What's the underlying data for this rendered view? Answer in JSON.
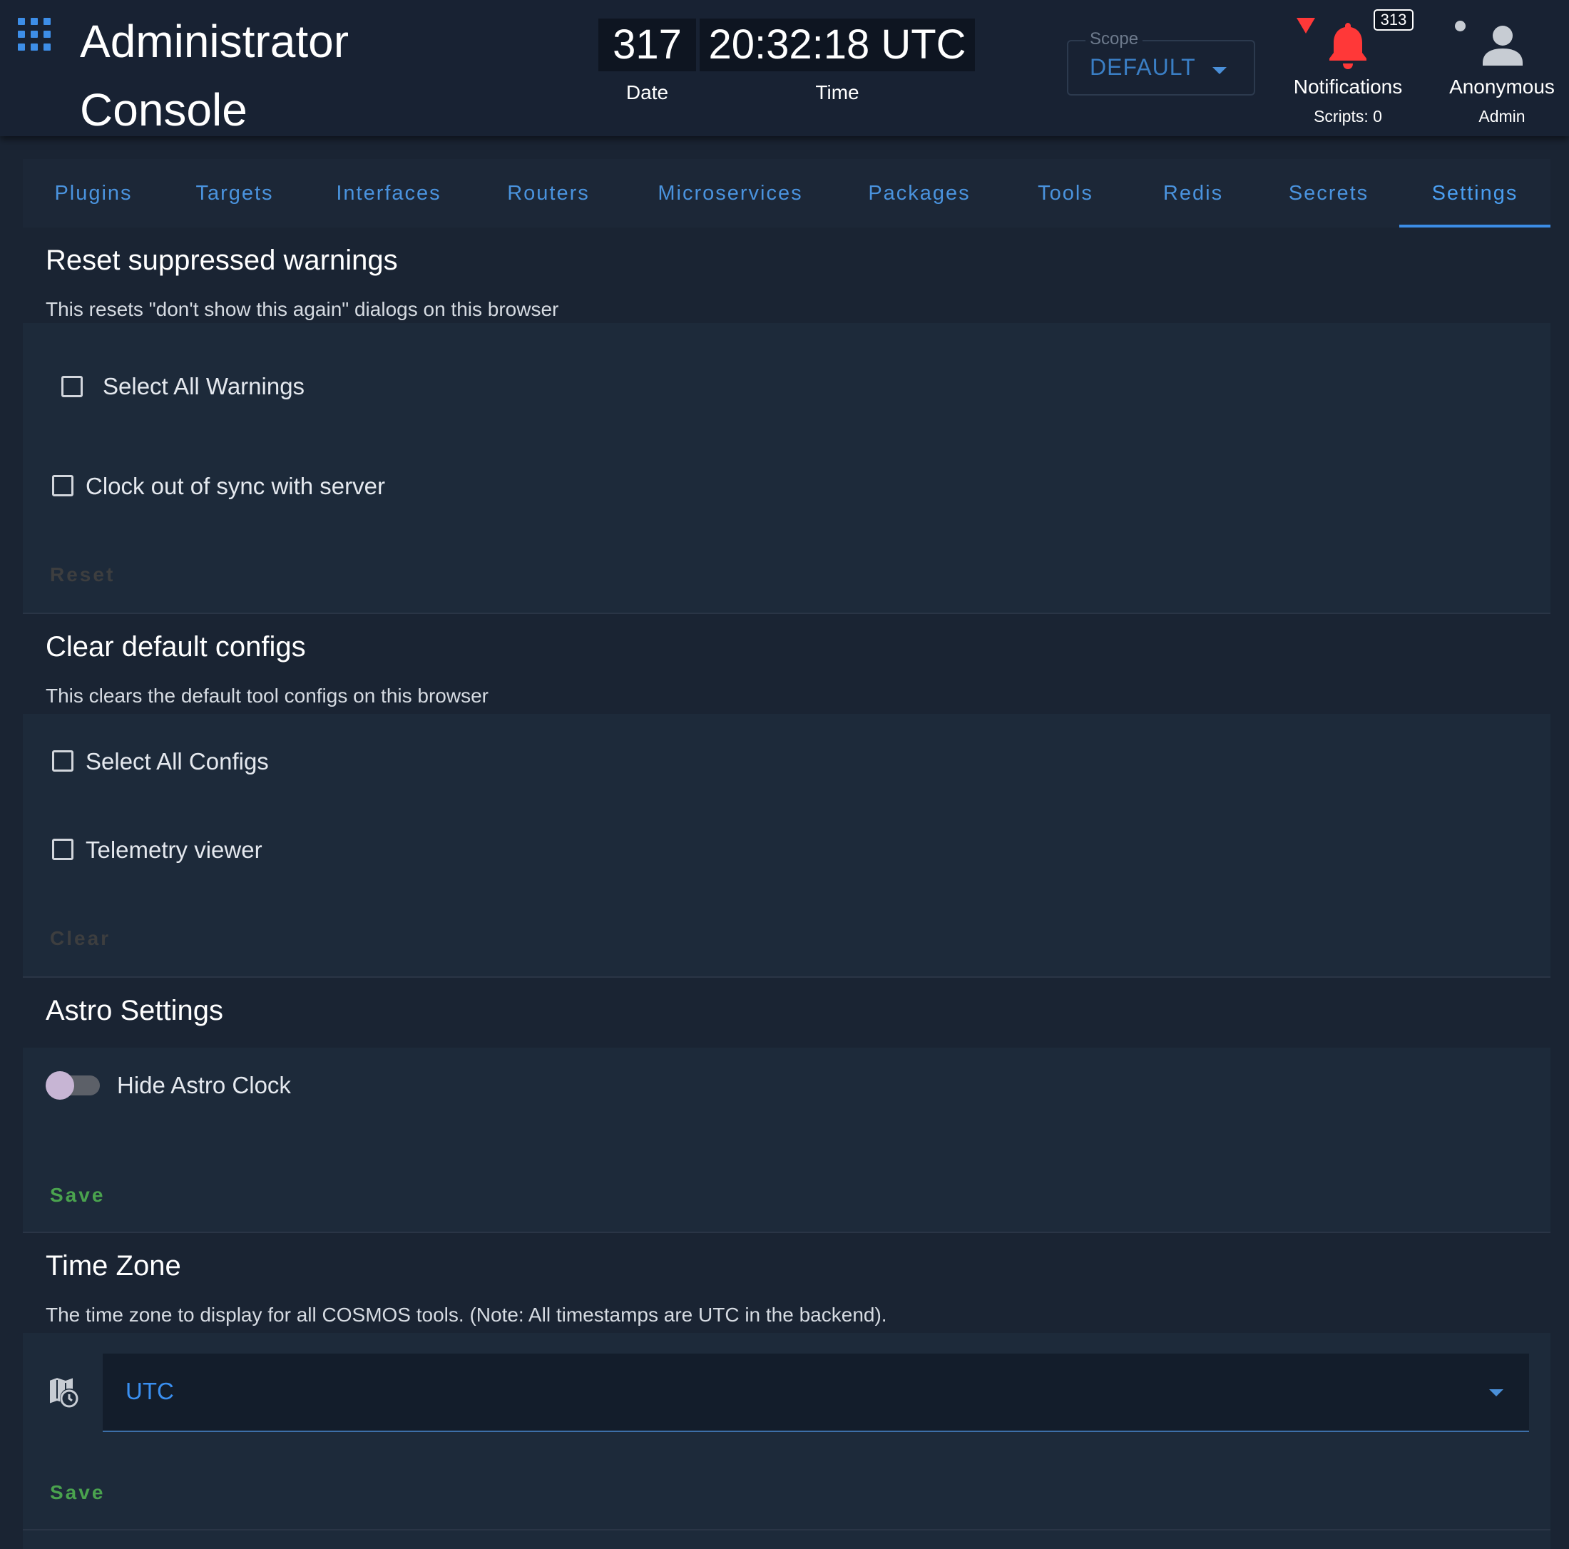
{
  "header": {
    "title": "Administrator Console",
    "date_value": "317",
    "date_label": "Date",
    "time_value": "20:32:18 UTC",
    "time_label": "Time",
    "scope_legend": "Scope",
    "scope_value": "DEFAULT",
    "notifications_badge": "313",
    "notifications_label": "Notifications",
    "scripts_label": "Scripts: 0",
    "user_name": "Anonymous",
    "user_role": "Admin"
  },
  "tabs": [
    {
      "label": "Plugins",
      "active": false
    },
    {
      "label": "Targets",
      "active": false
    },
    {
      "label": "Interfaces",
      "active": false
    },
    {
      "label": "Routers",
      "active": false
    },
    {
      "label": "Microservices",
      "active": false
    },
    {
      "label": "Packages",
      "active": false
    },
    {
      "label": "Tools",
      "active": false
    },
    {
      "label": "Redis",
      "active": false
    },
    {
      "label": "Secrets",
      "active": false
    },
    {
      "label": "Settings",
      "active": true
    }
  ],
  "warnings": {
    "title": "Reset suppressed warnings",
    "subtitle": "This resets \"don't show this again\" dialogs on this browser",
    "select_all": "Select All Warnings",
    "item1": "Clock out of sync with server",
    "button": "Reset"
  },
  "configs": {
    "title": "Clear default configs",
    "subtitle": "This clears the default tool configs on this browser",
    "select_all": "Select All Configs",
    "item1": "Telemetry viewer",
    "button": "Clear"
  },
  "astro": {
    "title": "Astro Settings",
    "toggle_label": "Hide Astro Clock",
    "toggle_on": false,
    "button": "Save"
  },
  "timezone": {
    "title": "Time Zone",
    "subtitle": "The time zone to display for all COSMOS tools. (Note: All timestamps are UTC in the backend).",
    "value": "UTC",
    "button": "Save"
  },
  "colors": {
    "accent": "#4a93de",
    "save": "#4aa34e",
    "alert": "#ff3838"
  }
}
